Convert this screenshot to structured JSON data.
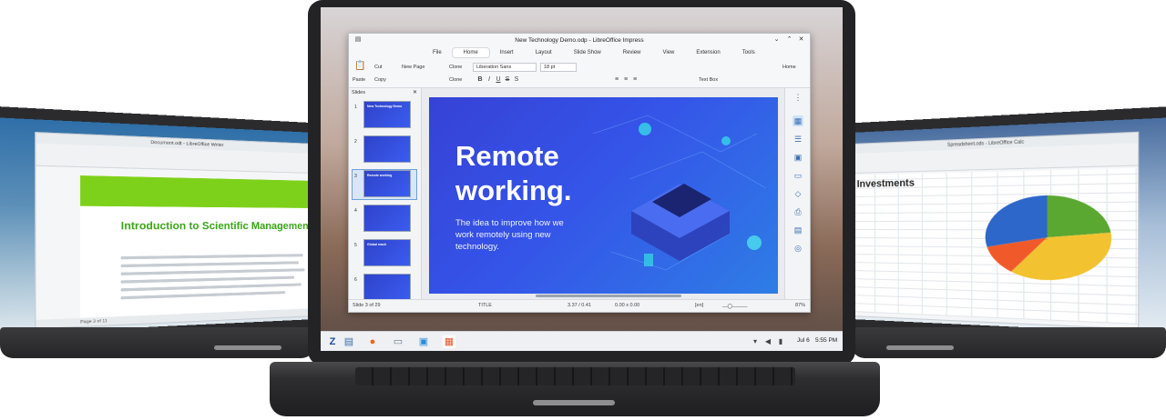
{
  "left_app": {
    "title": "Document.odt - LibreOffice Writer",
    "heading": "Introduction to Scientific Management",
    "status": "Page 3 of 11"
  },
  "right_app": {
    "title": "Spreadsheet.ods - LibreOffice Calc",
    "heading": "Investments",
    "pie_colors": [
      "#2d67c9",
      "#5aa832",
      "#f2c230",
      "#f05a2a"
    ]
  },
  "impress": {
    "title": "New Technology Demo.odp - LibreOffice Impress",
    "tabs": [
      "File",
      "Home",
      "Insert",
      "Layout",
      "Slide Show",
      "Review",
      "View",
      "Extension",
      "Tools"
    ],
    "ribbon": {
      "paste": "Paste",
      "cut": "Cut",
      "copy": "Copy",
      "clone": "Clone",
      "new_page": "New Page",
      "clone2": "Clone",
      "font_name": "Liberation Sans",
      "font_size": "18 pt",
      "text_box": "Text Box",
      "home": "Home"
    },
    "pane_title": "Slides",
    "thumbs": [
      {
        "num": "1",
        "text": "New Technology Demo"
      },
      {
        "num": "2",
        "text": ""
      },
      {
        "num": "3",
        "text": "Remote working"
      },
      {
        "num": "4",
        "text": ""
      },
      {
        "num": "5",
        "text": "Global reach"
      },
      {
        "num": "6",
        "text": ""
      }
    ],
    "slide": {
      "title": "Remote working.",
      "body": "The idea to improve how we work remotely using new technology."
    },
    "status": {
      "slide": "Slide 3 of 29",
      "layout": "TITLE",
      "pos": "3.37 / 0.41",
      "size": "0.00 x 0.00",
      "lang": "[en]",
      "zoom": "87%"
    }
  },
  "taskbar": {
    "date": "Jul 6",
    "time": "5:55 PM"
  }
}
